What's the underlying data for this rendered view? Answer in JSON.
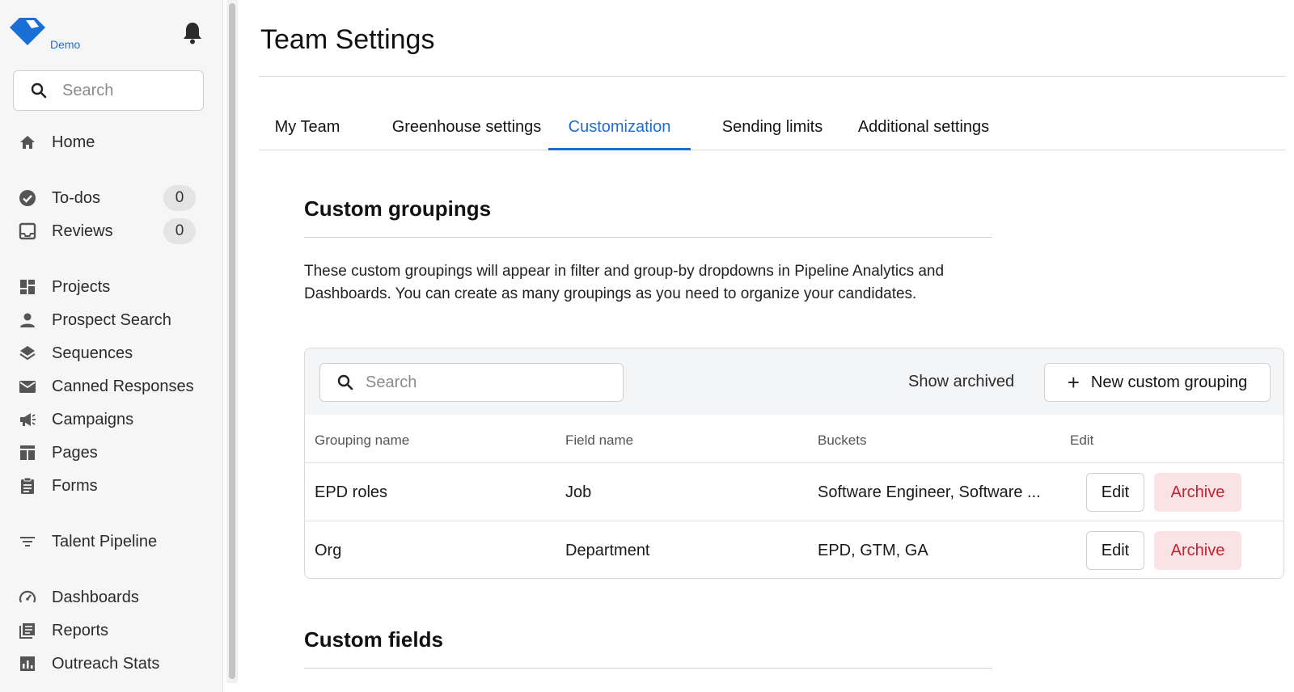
{
  "sidebar": {
    "workspace": "Demo",
    "search_placeholder": "Search",
    "items": [
      {
        "label": "Home",
        "icon": "home-icon"
      },
      {
        "label": "To-dos",
        "icon": "check-circle-icon",
        "count": "0"
      },
      {
        "label": "Reviews",
        "icon": "inbox-icon",
        "count": "0"
      },
      {
        "label": "Projects",
        "icon": "dashboard-grid-icon"
      },
      {
        "label": "Prospect Search",
        "icon": "person-icon"
      },
      {
        "label": "Sequences",
        "icon": "layers-icon"
      },
      {
        "label": "Canned Responses",
        "icon": "mail-icon"
      },
      {
        "label": "Campaigns",
        "icon": "megaphone-icon"
      },
      {
        "label": "Pages",
        "icon": "pages-icon"
      },
      {
        "label": "Forms",
        "icon": "clipboard-icon"
      },
      {
        "label": "Talent Pipeline",
        "icon": "filter-icon"
      },
      {
        "label": "Dashboards",
        "icon": "gauge-icon"
      },
      {
        "label": "Reports",
        "icon": "reports-icon"
      },
      {
        "label": "Outreach Stats",
        "icon": "bar-chart-icon"
      }
    ]
  },
  "page": {
    "title": "Team Settings",
    "tabs": [
      {
        "label": "My Team"
      },
      {
        "label": "Greenhouse settings"
      },
      {
        "label": "Customization",
        "active": true
      },
      {
        "label": "Sending limits"
      },
      {
        "label": "Additional settings"
      }
    ]
  },
  "custom_groupings": {
    "title": "Custom groupings",
    "description": "These custom groupings will appear in filter and group-by dropdowns in Pipeline Analytics and Dashboards. You can create as many groupings as you need to organize your candidates.",
    "search_placeholder": "Search",
    "show_archived": "Show archived",
    "new_button": "New custom grouping",
    "columns": [
      "Grouping name",
      "Field name",
      "Buckets",
      "Edit"
    ],
    "rows": [
      {
        "name": "EPD roles",
        "field": "Job",
        "buckets": "Software Engineer, Software ...",
        "edit": "Edit",
        "archive": "Archive"
      },
      {
        "name": "Org",
        "field": "Department",
        "buckets": "EPD, GTM, GA",
        "edit": "Edit",
        "archive": "Archive"
      }
    ]
  },
  "custom_fields": {
    "title": "Custom fields"
  },
  "colors": {
    "accent": "#1a6fd6",
    "archive_text": "#c8202f",
    "archive_bg": "#fbe3e5"
  }
}
